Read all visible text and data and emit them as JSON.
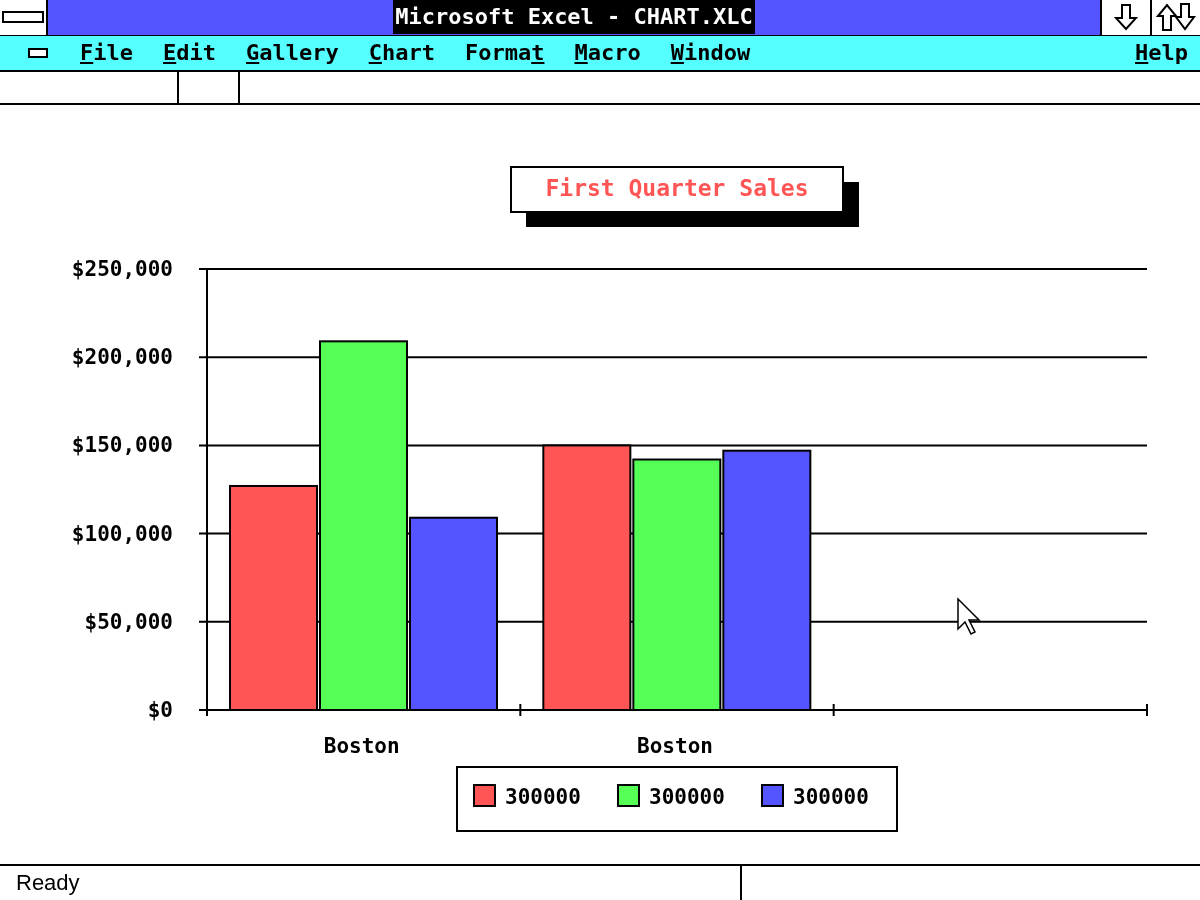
{
  "window": {
    "title": "Microsoft Excel - CHART.XLC"
  },
  "menu": [
    {
      "key": "F",
      "post": "ile"
    },
    {
      "key": "E",
      "post": "dit"
    },
    {
      "key": "G",
      "post": "allery"
    },
    {
      "key": "C",
      "post": "hart"
    },
    {
      "pre": "Forma",
      "key": "t"
    },
    {
      "key": "M",
      "post": "acro"
    },
    {
      "key": "W",
      "post": "indow"
    }
  ],
  "menu_right": [
    {
      "key": "H",
      "post": "elp"
    }
  ],
  "chart": {
    "chart_data": {
      "type": "bar",
      "title": "First Quarter Sales",
      "categories": [
        "Boston",
        "Boston",
        null
      ],
      "series": [
        {
          "name": "300000",
          "color": "#ff5555",
          "values": [
            127000,
            150000,
            null
          ]
        },
        {
          "name": "300000",
          "color": "#55ff55",
          "values": [
            209000,
            142000,
            null
          ]
        },
        {
          "name": "300000",
          "color": "#5555ff",
          "values": [
            109000,
            147000,
            null
          ]
        }
      ],
      "ylim": [
        0,
        250000
      ],
      "grid": true,
      "yticks": [
        {
          "value": 0,
          "label": "$0"
        },
        {
          "value": 50000,
          "label": "$50,000"
        },
        {
          "value": 100000,
          "label": "$100,000"
        },
        {
          "value": 150000,
          "label": "$150,000"
        },
        {
          "value": 200000,
          "label": "$200,000"
        },
        {
          "value": 250000,
          "label": "$250,000"
        }
      ]
    }
  },
  "status_bar": {
    "text": "Ready"
  }
}
